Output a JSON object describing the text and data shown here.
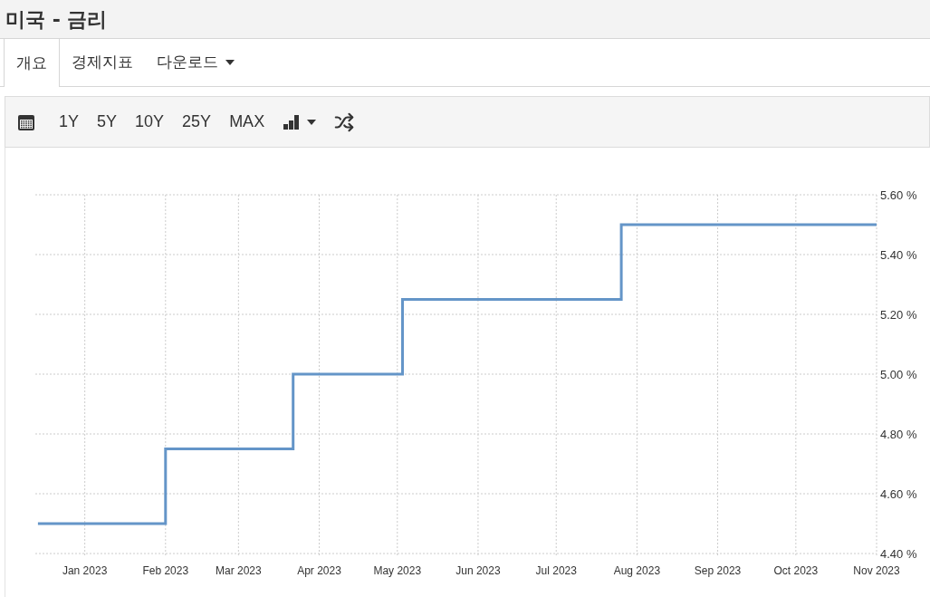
{
  "title": "미국 - 금리",
  "tabs": [
    {
      "label": "개요",
      "selected": true,
      "kind": "tab"
    },
    {
      "label": "경제지표",
      "selected": false,
      "kind": "tab"
    },
    {
      "label": "다운로드",
      "selected": false,
      "kind": "dropdown"
    }
  ],
  "toolbar": {
    "ranges": [
      "1Y",
      "5Y",
      "10Y",
      "25Y",
      "MAX"
    ]
  },
  "chart_data": {
    "type": "line",
    "x": [
      "2022-12-14",
      "2023-02-01",
      "2023-02-01",
      "2023-03-22",
      "2023-03-22",
      "2023-05-03",
      "2023-05-03",
      "2023-07-26",
      "2023-07-26",
      "2023-11-01"
    ],
    "xlim": [
      "2022-12-13",
      "2023-11-01"
    ],
    "grid": true,
    "series": [
      {
        "color": "#6495c8",
        "values": [
          4.5,
          4.5,
          4.75,
          4.75,
          5.0,
          5.0,
          5.25,
          5.25,
          5.5,
          5.5
        ]
      }
    ],
    "ylim": [
      4.4,
      5.6
    ],
    "yticks": [
      {
        "value": 4.4,
        "label": "4.40 %"
      },
      {
        "value": 4.6,
        "label": "4.60 %"
      },
      {
        "value": 4.8,
        "label": "4.80 %"
      },
      {
        "value": 5.0,
        "label": "5.00 %"
      },
      {
        "value": 5.2,
        "label": "5.20 %"
      },
      {
        "value": 5.4,
        "label": "5.40 %"
      },
      {
        "value": 5.6,
        "label": "5.60 %"
      }
    ],
    "xticks": [
      {
        "value": "2023-01-01",
        "label": "Jan 2023"
      },
      {
        "value": "2023-02-01",
        "label": "Feb 2023"
      },
      {
        "value": "2023-03-01",
        "label": "Mar 2023"
      },
      {
        "value": "2023-04-01",
        "label": "Apr 2023"
      },
      {
        "value": "2023-05-01",
        "label": "May 2023"
      },
      {
        "value": "2023-06-01",
        "label": "Jun 2023"
      },
      {
        "value": "2023-07-01",
        "label": "Jul 2023"
      },
      {
        "value": "2023-08-01",
        "label": "Aug 2023"
      },
      {
        "value": "2023-09-01",
        "label": "Sep 2023"
      },
      {
        "value": "2023-10-01",
        "label": "Oct 2023"
      },
      {
        "value": "2023-11-01",
        "label": "Nov 2023"
      }
    ]
  }
}
